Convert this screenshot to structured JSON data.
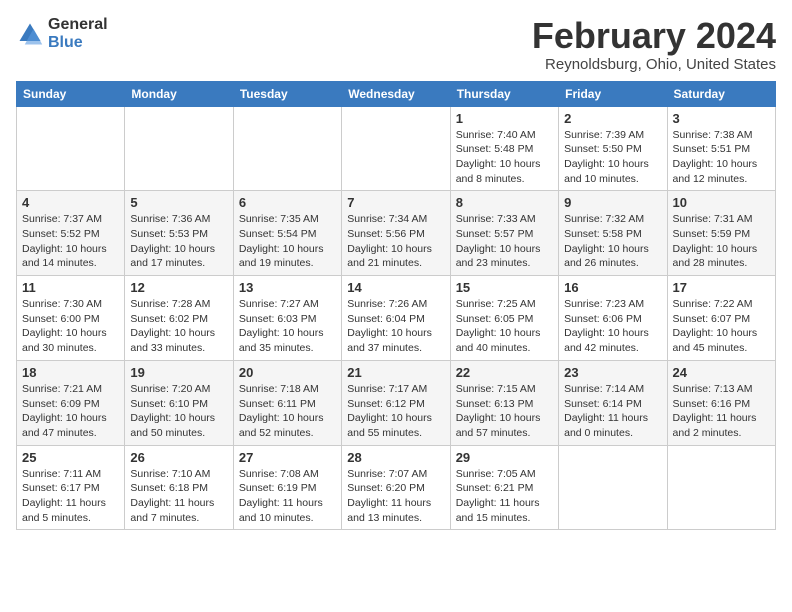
{
  "header": {
    "logo_line1": "General",
    "logo_line2": "Blue",
    "title": "February 2024",
    "subtitle": "Reynoldsburg, Ohio, United States"
  },
  "weekdays": [
    "Sunday",
    "Monday",
    "Tuesday",
    "Wednesday",
    "Thursday",
    "Friday",
    "Saturday"
  ],
  "weeks": [
    [
      {
        "day": "",
        "detail": ""
      },
      {
        "day": "",
        "detail": ""
      },
      {
        "day": "",
        "detail": ""
      },
      {
        "day": "",
        "detail": ""
      },
      {
        "day": "1",
        "detail": "Sunrise: 7:40 AM\nSunset: 5:48 PM\nDaylight: 10 hours\nand 8 minutes."
      },
      {
        "day": "2",
        "detail": "Sunrise: 7:39 AM\nSunset: 5:50 PM\nDaylight: 10 hours\nand 10 minutes."
      },
      {
        "day": "3",
        "detail": "Sunrise: 7:38 AM\nSunset: 5:51 PM\nDaylight: 10 hours\nand 12 minutes."
      }
    ],
    [
      {
        "day": "4",
        "detail": "Sunrise: 7:37 AM\nSunset: 5:52 PM\nDaylight: 10 hours\nand 14 minutes."
      },
      {
        "day": "5",
        "detail": "Sunrise: 7:36 AM\nSunset: 5:53 PM\nDaylight: 10 hours\nand 17 minutes."
      },
      {
        "day": "6",
        "detail": "Sunrise: 7:35 AM\nSunset: 5:54 PM\nDaylight: 10 hours\nand 19 minutes."
      },
      {
        "day": "7",
        "detail": "Sunrise: 7:34 AM\nSunset: 5:56 PM\nDaylight: 10 hours\nand 21 minutes."
      },
      {
        "day": "8",
        "detail": "Sunrise: 7:33 AM\nSunset: 5:57 PM\nDaylight: 10 hours\nand 23 minutes."
      },
      {
        "day": "9",
        "detail": "Sunrise: 7:32 AM\nSunset: 5:58 PM\nDaylight: 10 hours\nand 26 minutes."
      },
      {
        "day": "10",
        "detail": "Sunrise: 7:31 AM\nSunset: 5:59 PM\nDaylight: 10 hours\nand 28 minutes."
      }
    ],
    [
      {
        "day": "11",
        "detail": "Sunrise: 7:30 AM\nSunset: 6:00 PM\nDaylight: 10 hours\nand 30 minutes."
      },
      {
        "day": "12",
        "detail": "Sunrise: 7:28 AM\nSunset: 6:02 PM\nDaylight: 10 hours\nand 33 minutes."
      },
      {
        "day": "13",
        "detail": "Sunrise: 7:27 AM\nSunset: 6:03 PM\nDaylight: 10 hours\nand 35 minutes."
      },
      {
        "day": "14",
        "detail": "Sunrise: 7:26 AM\nSunset: 6:04 PM\nDaylight: 10 hours\nand 37 minutes."
      },
      {
        "day": "15",
        "detail": "Sunrise: 7:25 AM\nSunset: 6:05 PM\nDaylight: 10 hours\nand 40 minutes."
      },
      {
        "day": "16",
        "detail": "Sunrise: 7:23 AM\nSunset: 6:06 PM\nDaylight: 10 hours\nand 42 minutes."
      },
      {
        "day": "17",
        "detail": "Sunrise: 7:22 AM\nSunset: 6:07 PM\nDaylight: 10 hours\nand 45 minutes."
      }
    ],
    [
      {
        "day": "18",
        "detail": "Sunrise: 7:21 AM\nSunset: 6:09 PM\nDaylight: 10 hours\nand 47 minutes."
      },
      {
        "day": "19",
        "detail": "Sunrise: 7:20 AM\nSunset: 6:10 PM\nDaylight: 10 hours\nand 50 minutes."
      },
      {
        "day": "20",
        "detail": "Sunrise: 7:18 AM\nSunset: 6:11 PM\nDaylight: 10 hours\nand 52 minutes."
      },
      {
        "day": "21",
        "detail": "Sunrise: 7:17 AM\nSunset: 6:12 PM\nDaylight: 10 hours\nand 55 minutes."
      },
      {
        "day": "22",
        "detail": "Sunrise: 7:15 AM\nSunset: 6:13 PM\nDaylight: 10 hours\nand 57 minutes."
      },
      {
        "day": "23",
        "detail": "Sunrise: 7:14 AM\nSunset: 6:14 PM\nDaylight: 11 hours\nand 0 minutes."
      },
      {
        "day": "24",
        "detail": "Sunrise: 7:13 AM\nSunset: 6:16 PM\nDaylight: 11 hours\nand 2 minutes."
      }
    ],
    [
      {
        "day": "25",
        "detail": "Sunrise: 7:11 AM\nSunset: 6:17 PM\nDaylight: 11 hours\nand 5 minutes."
      },
      {
        "day": "26",
        "detail": "Sunrise: 7:10 AM\nSunset: 6:18 PM\nDaylight: 11 hours\nand 7 minutes."
      },
      {
        "day": "27",
        "detail": "Sunrise: 7:08 AM\nSunset: 6:19 PM\nDaylight: 11 hours\nand 10 minutes."
      },
      {
        "day": "28",
        "detail": "Sunrise: 7:07 AM\nSunset: 6:20 PM\nDaylight: 11 hours\nand 13 minutes."
      },
      {
        "day": "29",
        "detail": "Sunrise: 7:05 AM\nSunset: 6:21 PM\nDaylight: 11 hours\nand 15 minutes."
      },
      {
        "day": "",
        "detail": ""
      },
      {
        "day": "",
        "detail": ""
      }
    ]
  ]
}
